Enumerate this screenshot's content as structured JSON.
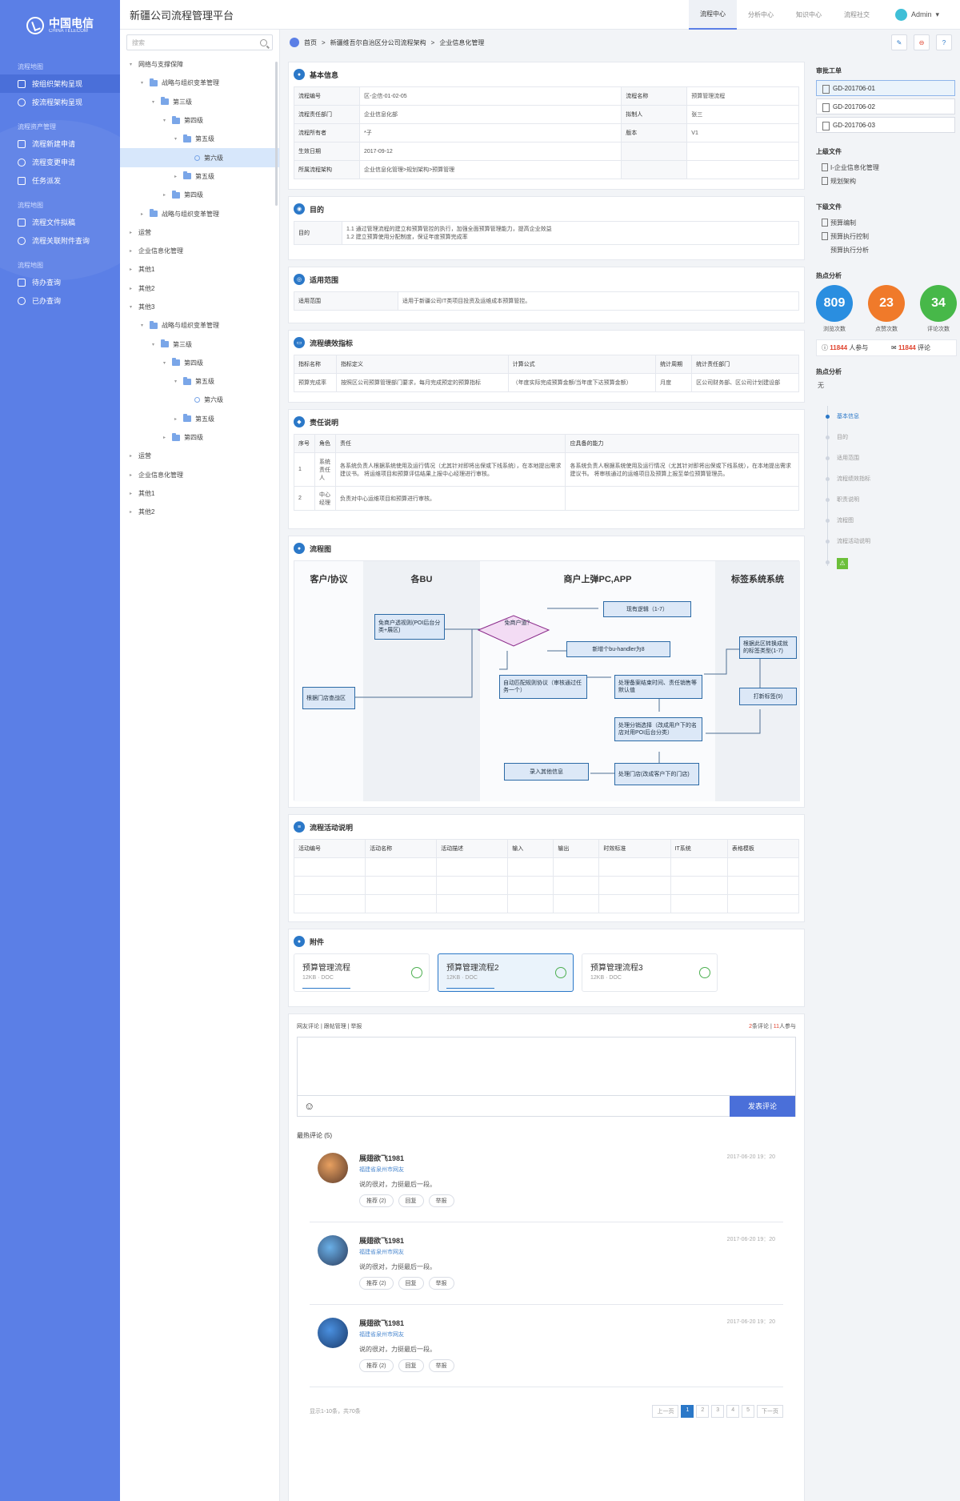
{
  "app": {
    "title": "新疆公司流程管理平台",
    "logo_cn": "中国电信",
    "logo_en": "CHINA TELECOM"
  },
  "header": {
    "tabs": [
      "流程中心",
      "分析中心",
      "知识中心",
      "流程社交"
    ],
    "user": "Admin"
  },
  "nav": {
    "sections": [
      {
        "title": "流程地图",
        "items": [
          "按组织架构呈现",
          "按流程架构呈现"
        ]
      },
      {
        "title": "流程资产管理",
        "items": [
          "流程新建申请",
          "流程变更申请",
          "任务派发"
        ]
      },
      {
        "title": "流程地图",
        "items": [
          "流程文件拟稿",
          "流程关联附件查询"
        ]
      },
      {
        "title": "流程地图",
        "items": [
          "待办查询",
          "已办查询"
        ]
      }
    ]
  },
  "tree": {
    "search_placeholder": "搜索",
    "nodes": [
      {
        "label": "网络与支撑保障",
        "depth": 0,
        "arrow": "▾"
      },
      {
        "label": "战略与组织变革管理",
        "depth": 1,
        "arrow": "▾",
        "folder": true
      },
      {
        "label": "第三级",
        "depth": 2,
        "arrow": "▾",
        "folder": true
      },
      {
        "label": "第四级",
        "depth": 3,
        "arrow": "▾",
        "folder": true
      },
      {
        "label": "第五级",
        "depth": 4,
        "arrow": "▾",
        "folder": true
      },
      {
        "label": "第六级",
        "depth": 5,
        "dot": true,
        "selected": true
      },
      {
        "label": "第五级",
        "depth": 4,
        "arrow": "▸",
        "folder": true
      },
      {
        "label": "第四级",
        "depth": 3,
        "arrow": "▸",
        "folder": true
      },
      {
        "label": "战略与组织变革管理",
        "depth": 1,
        "arrow": "▸",
        "folder": true
      },
      {
        "label": "运营",
        "depth": 0,
        "arrow": "▸"
      },
      {
        "label": "企业信息化管理",
        "depth": 0,
        "arrow": "▸"
      },
      {
        "label": "其他1",
        "depth": 0,
        "arrow": "▸"
      },
      {
        "label": "其他2",
        "depth": 0,
        "arrow": "▸"
      },
      {
        "label": "其他3",
        "depth": 0,
        "arrow": "▾"
      },
      {
        "label": "战略与组织变革管理",
        "depth": 1,
        "arrow": "▾",
        "folder": true
      },
      {
        "label": "第三级",
        "depth": 2,
        "arrow": "▾",
        "folder": true
      },
      {
        "label": "第四级",
        "depth": 3,
        "arrow": "▾",
        "folder": true
      },
      {
        "label": "第五级",
        "depth": 4,
        "arrow": "▾",
        "folder": true
      },
      {
        "label": "第六级",
        "depth": 5,
        "dot": true
      },
      {
        "label": "第五级",
        "depth": 4,
        "arrow": "▸",
        "folder": true
      },
      {
        "label": "第四级",
        "depth": 3,
        "arrow": "▸",
        "folder": true
      },
      {
        "label": "运营",
        "depth": 0,
        "arrow": "▸"
      },
      {
        "label": "企业信息化管理",
        "depth": 0,
        "arrow": "▸"
      },
      {
        "label": "其他1",
        "depth": 0,
        "arrow": "▸"
      },
      {
        "label": "其他2",
        "depth": 0,
        "arrow": "▸"
      }
    ]
  },
  "breadcrumb": {
    "items": [
      "首页",
      "新疆维吾尔自治区分公司流程架构",
      "企业信息化管理"
    ]
  },
  "basic": {
    "title": "基本信息",
    "rows": [
      [
        "流程编号",
        "区-企信-01-02-05",
        "流程名称",
        "预算管理流程"
      ],
      [
        "流程责任部门",
        "企业信息化部",
        "拟制人",
        "张三"
      ],
      [
        "流程所有者",
        "*子",
        "版本",
        "V1"
      ],
      [
        "生效日期",
        "2017-09-12",
        "",
        ""
      ],
      [
        "所属流程架构",
        "企业信息化管理>规划架构>预算管理",
        "",
        ""
      ]
    ]
  },
  "purpose": {
    "title": "目的",
    "label": "目的",
    "lines": [
      "1.1 通过管理流程的建立和预算管控的执行，加强全面预算管理能力，提高企业效益",
      "1.2 建立预算使用分配制度，保证年度预算完成率"
    ]
  },
  "scope": {
    "title": "适用范围",
    "label": "适用范围",
    "text": "适用于新疆公司IT类项目投资及运维成本预算管控。"
  },
  "kpi": {
    "title": "流程绩效指标",
    "headers": [
      "指标名称",
      "指标定义",
      "计算公式",
      "统计周期",
      "统计责任部门"
    ],
    "row": [
      "预算完成率",
      "按照区公司预算管理部门要求，每月完成预定的预算指标",
      "（年度实际完成预算金额/当年度下达预算金额）",
      "月度",
      "区公司财务部、区公司计划建设部"
    ]
  },
  "resp": {
    "title": "责任说明",
    "headers": [
      "序号",
      "角色",
      "责任",
      "应具备的能力"
    ],
    "rows": [
      [
        "1",
        "系统责任人",
        "各系统负责人根据系统使用及运行情况（尤其针对即将出保或下线系统），在本地提出需求建议书。 将运维项目和预算评估结果上报中心经理进行审核。",
        "各系统负责人根据系统使用及运行情况（尤其针对即将出保或下线系统），在本地提出需求建议书。 将审核通过的运维项目及预算上报至单位预算管理员。"
      ],
      [
        "2",
        "中心经理",
        "负责对中心运维项目和预算进行审核。",
        ""
      ]
    ]
  },
  "flow": {
    "title": "流程图",
    "lanes": [
      "客户/协议",
      "各BU",
      "商户上弹PC,APP",
      "标签系统系统"
    ],
    "boxes": {
      "b1": "免商户透视则(POI后台分类+展区)",
      "d1": "免商户道？",
      "b2": "现有逻辑（1-7）",
      "b3": "新增个bu-handler为8",
      "b4": "根据此区转换成就的标签类型(1-7)",
      "b5": "自动匹配规则协议（审核通过任务一个）",
      "b6": "处理备案结束时间、责任销售等默认值",
      "b7": "打新标签(9)",
      "b8": "根据门店查战区",
      "b9": "处理分销选择（改成用户下的名店对用POI后台分类）",
      "b10": "录入其他信息",
      "b11": "处理门店(改成客户下的门店)"
    }
  },
  "activity": {
    "title": "流程活动说明",
    "headers": [
      "活动编号",
      "活动名称",
      "活动描述",
      "输入",
      "输出",
      "时效标准",
      "IT系统",
      "表格模板"
    ]
  },
  "attach": {
    "title": "附件",
    "items": [
      {
        "name": "预算管理流程",
        "meta": "12KB · DOC"
      },
      {
        "name": "预算管理流程2",
        "meta": "12KB · DOC"
      },
      {
        "name": "预算管理流程3",
        "meta": "12KB · DOC"
      }
    ]
  },
  "comment": {
    "tabs": "网友评论 | 跟帖管理 | 举报",
    "count_a": "2",
    "count_a_label": "条评论",
    "count_b": "11",
    "count_b_label": "人参与",
    "submit": "发表评论",
    "hot": "最热评论 (5)",
    "items": [
      {
        "name": "展翅欲飞1981",
        "loc": "福建省泉州市网友",
        "text": "说的很对，力挺最后一段。",
        "date": "2017-06-20 19：20",
        "b1": "推荐 (2)",
        "b2": "回复",
        "b3": "举报"
      },
      {
        "name": "展翅欲飞1981",
        "loc": "福建省泉州市网友",
        "text": "说的很对，力挺最后一段。",
        "date": "2017-06-20 19：20",
        "b1": "推荐 (2)",
        "b2": "回复",
        "b3": "举报"
      },
      {
        "name": "展翅欲飞1981",
        "loc": "福建省泉州市网友",
        "text": "说的很对，力挺最后一段。",
        "date": "2017-06-20 19：20",
        "b1": "推荐 (2)",
        "b2": "回复",
        "b3": "举报"
      }
    ],
    "pager_info": "显示1-10条，共70条",
    "pages": [
      "上一页",
      "1",
      "2",
      "3",
      "4",
      "5",
      "下一页"
    ]
  },
  "right": {
    "orders_title": "审批工单",
    "orders": [
      "GD-201706-01",
      "GD-201706-02",
      "GD-201706-03"
    ],
    "up_title": "上级文件",
    "up": [
      "I-企业信息化管理",
      "规划架构"
    ],
    "down_title": "下级文件",
    "down": [
      "预算编制",
      "预算执行控制",
      "预算执行分析"
    ],
    "hot_title": "热点分析",
    "stats": [
      {
        "v": "809",
        "l": "浏览次数",
        "c": "#2a8ee0"
      },
      {
        "v": "23",
        "l": "点赞次数",
        "c": "#f07a2a"
      },
      {
        "v": "34",
        "l": "评论次数",
        "c": "#47b849"
      }
    ],
    "p1": "11844",
    "p1l": "人参与",
    "p2": "11844",
    "p2l": "评论",
    "hot2_title": "热点分析",
    "none": "无",
    "toc": [
      "基本信息",
      "目的",
      "适用范围",
      "流程绩效指标",
      "职责说明",
      "流程图",
      "流程活动说明"
    ]
  }
}
